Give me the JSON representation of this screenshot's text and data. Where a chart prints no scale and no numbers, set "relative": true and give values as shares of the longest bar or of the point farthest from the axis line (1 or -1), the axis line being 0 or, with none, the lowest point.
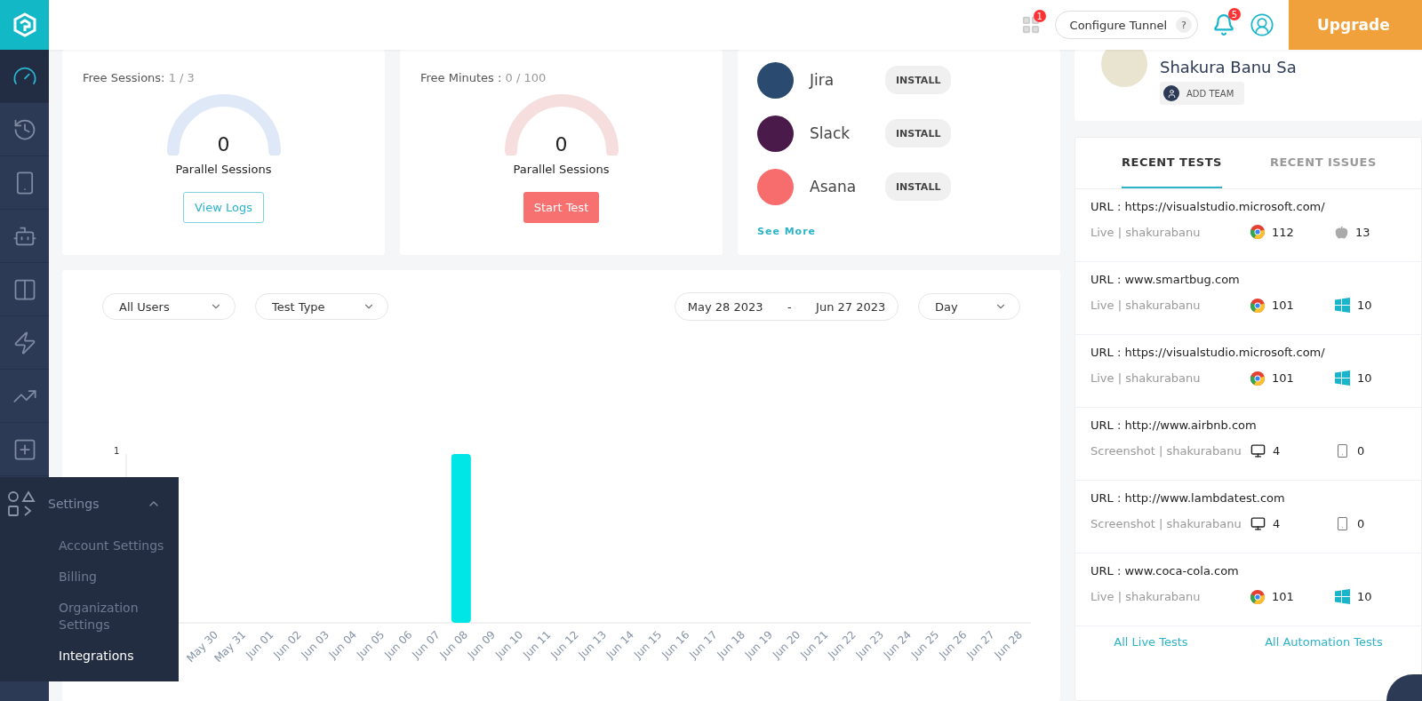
{
  "topbar": {
    "apps_badge": "1",
    "tunnel_button": "Configure Tunnel",
    "tunnel_help": "?",
    "notifications_badge": "5",
    "upgrade_button": "Upgrade"
  },
  "sidebar": {
    "items": [
      {
        "kind": "dashboard",
        "selected": true
      },
      {
        "kind": "history",
        "selected": false
      },
      {
        "kind": "mobile",
        "selected": false
      },
      {
        "kind": "robot",
        "selected": false
      },
      {
        "kind": "split",
        "selected": false
      },
      {
        "kind": "bolt",
        "selected": false
      },
      {
        "kind": "analytics",
        "selected": false
      },
      {
        "kind": "add",
        "selected": false
      }
    ]
  },
  "settings_menu": {
    "title": "Settings",
    "expanded": true,
    "items": [
      {
        "label": "Account Settings",
        "selected": false
      },
      {
        "label": "Billing",
        "selected": false
      },
      {
        "label": "Organization Settings",
        "selected": false
      },
      {
        "label": "Integrations",
        "selected": true
      }
    ]
  },
  "usage_cards": [
    {
      "label": "Free Sessions:",
      "count": "1 / 3",
      "value": "0",
      "caption": "Parallel Sessions",
      "button": "View Logs",
      "kind": "outline"
    },
    {
      "label": "Free Minutes :",
      "count": "0 / 100",
      "value": "0",
      "caption": "Parallel Sessions",
      "button": "Start Test",
      "kind": "filled"
    }
  ],
  "integrations": {
    "items": [
      {
        "name": "Jira",
        "button": "INSTALL",
        "color": "#2a4a70"
      },
      {
        "name": "Slack",
        "button": "INSTALL",
        "color": "#4a1a4a"
      },
      {
        "name": "Asana",
        "button": "INSTALL",
        "color": "#f76d6d"
      }
    ],
    "see_more": "See More"
  },
  "chart_card": {
    "filters": [
      "All Users",
      "Test Type"
    ],
    "date_from": "May 28 2023",
    "date_separator": "-",
    "date_to": "Jun 27 2023",
    "interval": "Day",
    "chart_data": {
      "type": "bar",
      "relative": true,
      "annotations": [
        {
          "text": "1"
        }
      ],
      "categories": [
        "May 30",
        "May 31",
        "Jun 01",
        "Jun 02",
        "Jun 03",
        "Jun 04",
        "Jun 05",
        "Jun 06",
        "Jun 07",
        "Jun 08",
        "Jun 09",
        "Jun 10",
        "Jun 11",
        "Jun 12",
        "Jun 13",
        "Jun 14",
        "Jun 15",
        "Jun 16",
        "Jun 17",
        "Jun 18",
        "Jun 19",
        "Jun 20",
        "Jun 21",
        "Jun 22",
        "Jun 23",
        "Jun 24",
        "Jun 25",
        "Jun 26",
        "Jun 27",
        "Jun 28"
      ],
      "values": [
        0,
        0,
        0,
        0,
        0,
        0,
        0,
        0,
        0,
        1,
        0,
        0,
        0,
        0,
        0,
        0,
        0,
        0,
        0,
        0,
        0,
        0,
        0,
        0,
        0,
        0,
        0,
        0,
        0,
        0
      ]
    }
  },
  "profile": {
    "name": "Shakura Banu Sa",
    "add_team": "ADD TEAM"
  },
  "recent": {
    "tabs": [
      {
        "label": "RECENT TESTS",
        "selected": true
      },
      {
        "label": "RECENT ISSUES",
        "selected": false
      }
    ],
    "tests": [
      {
        "url": "URL : https://visualstudio.microsoft.com/",
        "meta": "Live | shakurabanu",
        "stats": [
          {
            "kind": "chrome",
            "value": "112"
          },
          {
            "kind": "apple",
            "value": "13"
          }
        ]
      },
      {
        "url": "URL : www.smartbug.com",
        "meta": "Live | shakurabanu",
        "stats": [
          {
            "kind": "chrome",
            "value": "101"
          },
          {
            "kind": "windows",
            "value": "10"
          }
        ]
      },
      {
        "url": "URL : https://visualstudio.microsoft.com/",
        "meta": "Live | shakurabanu",
        "stats": [
          {
            "kind": "chrome",
            "value": "101"
          },
          {
            "kind": "windows",
            "value": "10"
          }
        ]
      },
      {
        "url": "URL : http://www.airbnb.com",
        "meta": "Screenshot | shakurabanu",
        "stats": [
          {
            "kind": "desktop",
            "value": "4"
          },
          {
            "kind": "mobile",
            "value": "0"
          }
        ]
      },
      {
        "url": "URL : http://www.lambdatest.com",
        "meta": "Screenshot | shakurabanu",
        "stats": [
          {
            "kind": "desktop",
            "value": "4"
          },
          {
            "kind": "mobile",
            "value": "0"
          }
        ]
      },
      {
        "url": "URL : www.coca-cola.com",
        "meta": "Live | shakurabanu",
        "stats": [
          {
            "kind": "chrome",
            "value": "101"
          },
          {
            "kind": "windows",
            "value": "10"
          }
        ]
      }
    ],
    "links": [
      "All Live Tests",
      "All Automation Tests"
    ]
  }
}
